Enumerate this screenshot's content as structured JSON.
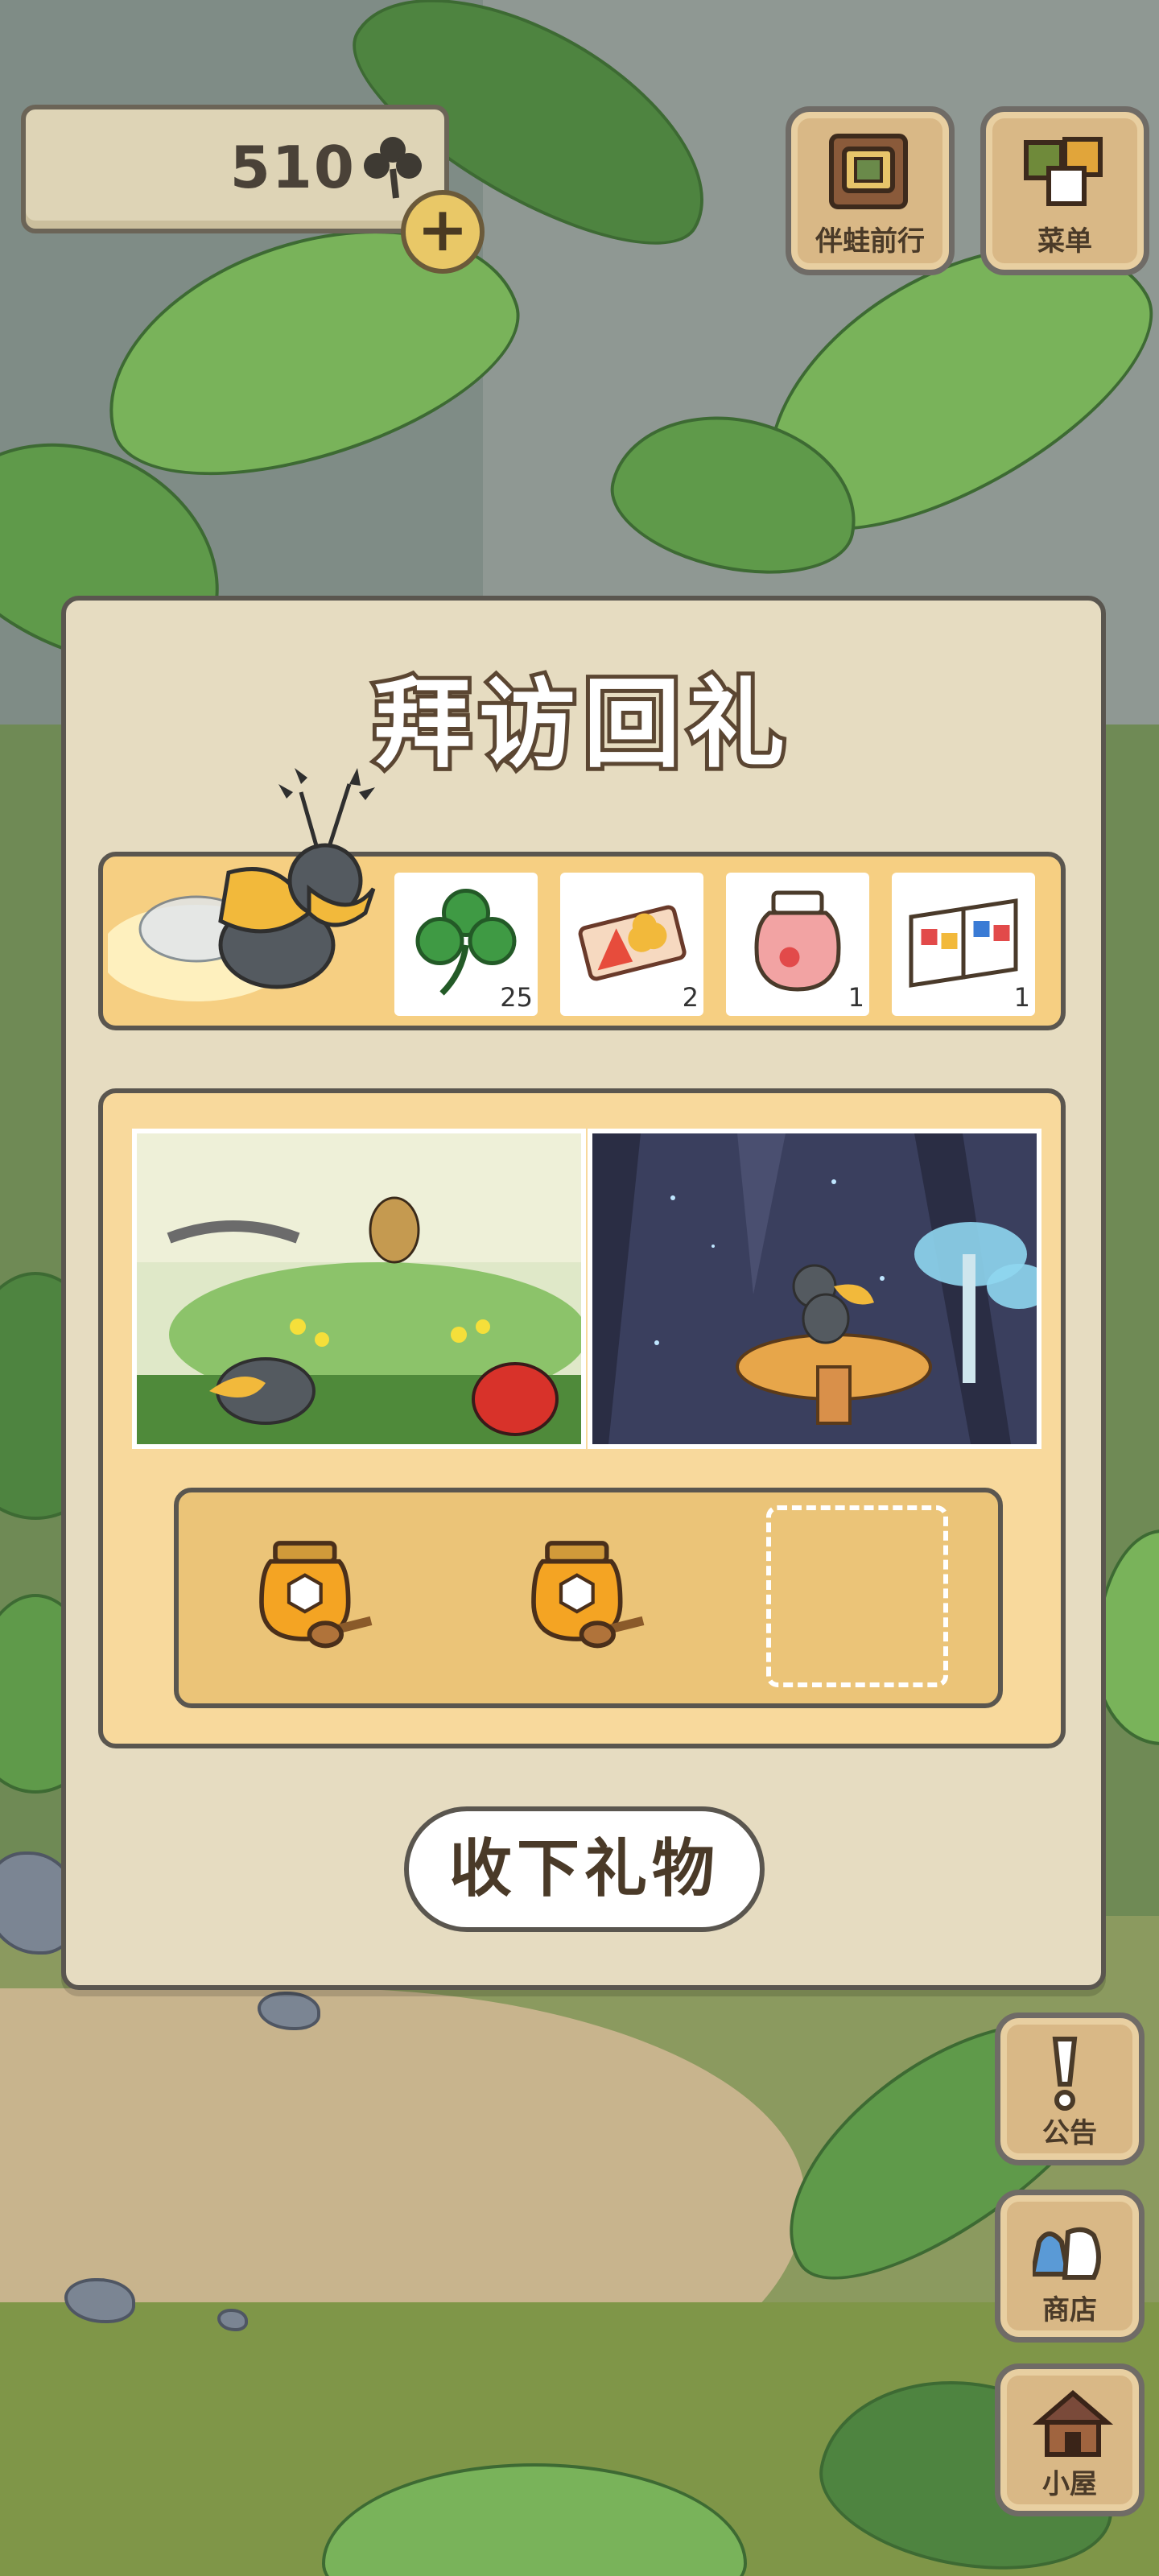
{
  "hud": {
    "clover_count": "510",
    "add_label": "+",
    "travel_button_label": "伴蛙前行",
    "menu_button_label": "菜单"
  },
  "modal": {
    "title": "拜访回礼",
    "rewards": [
      {
        "icon": "clover-icon",
        "count": "25"
      },
      {
        "icon": "ticket-icon",
        "count": "2"
      },
      {
        "icon": "jam-jar-icon",
        "count": "1"
      },
      {
        "icon": "brochure-icon",
        "count": "1"
      }
    ],
    "gift_slots": [
      {
        "icon": "honey-jar-icon",
        "filled": true
      },
      {
        "icon": "honey-jar-icon",
        "filled": true
      },
      {
        "icon": "",
        "filled": false
      }
    ],
    "receive_button_label": "收下礼物"
  },
  "side_menu": {
    "notice_label": "公告",
    "shop_label": "商店",
    "house_label": "小屋"
  },
  "colors": {
    "modal_bg": "#e6dcc1",
    "strip_bg": "#f6cf82",
    "panel_bg": "#f8d99c",
    "slot_bg": "#ebc478",
    "outline": "#5a564f"
  }
}
